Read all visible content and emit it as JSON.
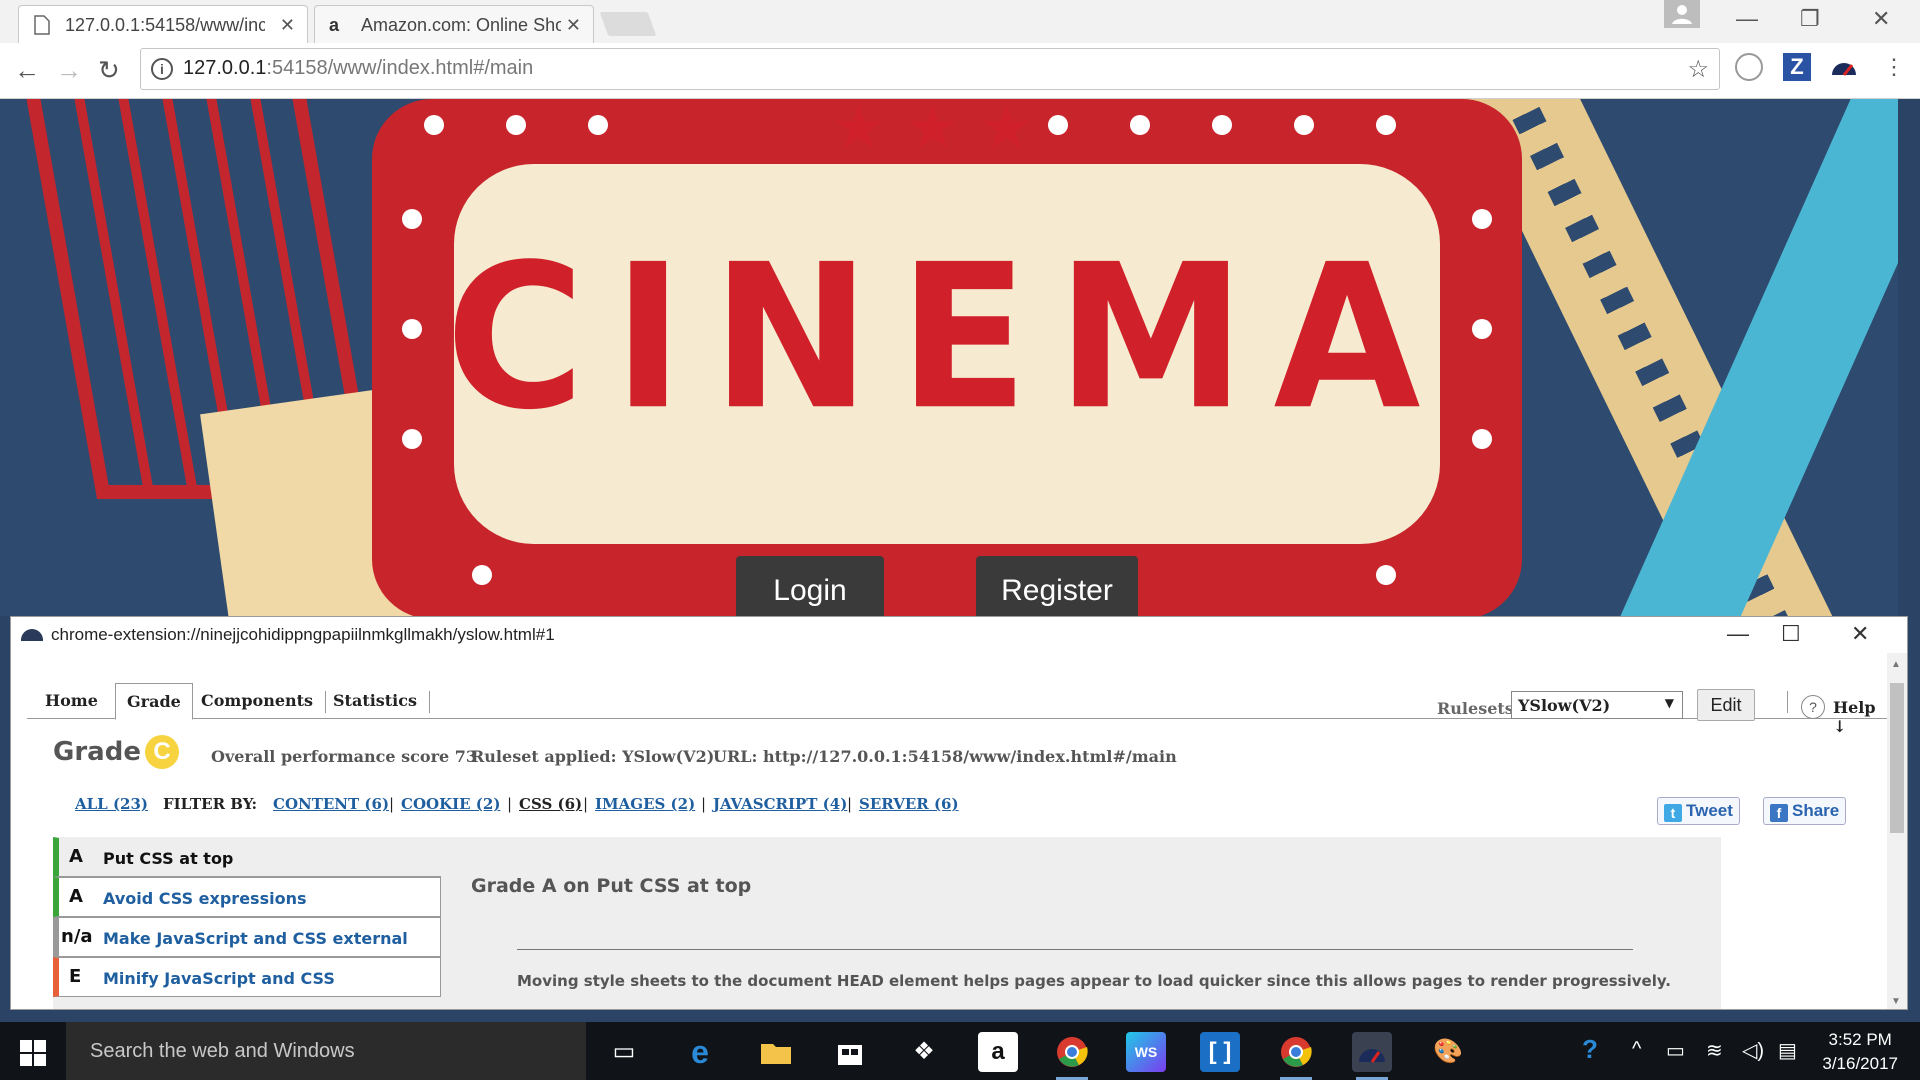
{
  "browser": {
    "tabs": [
      {
        "title": "127.0.0.1:54158/www/inc",
        "close": "✕"
      },
      {
        "title": "Amazon.com: Online Sho",
        "close": "✕"
      }
    ],
    "window_controls": {
      "minimize": "—",
      "restore": "❐",
      "close": "✕"
    },
    "nav": {
      "back": "←",
      "forward": "→",
      "reload": "↻"
    },
    "url_host": "127.0.0.1",
    "url_rest": ":54158/www/index.html#/main",
    "star": "☆"
  },
  "page": {
    "logo_text": "CINEMA",
    "stars": "★★★",
    "login_label": "Login",
    "register_label": "Register"
  },
  "yslow": {
    "window_title": "chrome-extension://ninejjcohidippngpapiilnmkgllmakh/yslow.html#1",
    "window_controls": {
      "minimize": "—",
      "maximize": "☐",
      "close": "✕"
    },
    "tabs": [
      "Home",
      "Grade",
      "Components",
      "Statistics"
    ],
    "rulesets_label": "Rulesets",
    "ruleset_value": "YSlow(V2)",
    "edit_label": "Edit",
    "help_label": "Help ↓",
    "help_icon": "?",
    "grade_label": "Grade",
    "grade_value": "C",
    "overall_score": "Overall performance score 73",
    "ruleset_applied": "Ruleset applied: YSlow(V2)",
    "url_text": "URL: http://127.0.0.1:54158/www/index.html#/main",
    "filters": {
      "all": "ALL (23)",
      "filter_by": "FILTER BY:",
      "content": "CONTENT (6)",
      "cookie": "COOKIE (2)",
      "css": "CSS (6)",
      "images": "IMAGES (2)",
      "javascript": "JAVASCRIPT (4)",
      "server": "SERVER (6)"
    },
    "tweet_label": "Tweet",
    "share_label": "Share",
    "rules": [
      {
        "grade": "A",
        "name": "Put CSS at top",
        "color": "#3aa63a"
      },
      {
        "grade": "A",
        "name": "Avoid CSS expressions",
        "color": "#3aa63a"
      },
      {
        "grade": "n/a",
        "name": "Make JavaScript and CSS external",
        "color": "#999999"
      },
      {
        "grade": "E",
        "name": "Minify JavaScript and CSS",
        "color": "#e8603a"
      }
    ],
    "detail_title": "Grade A on Put CSS at top",
    "detail_desc": "Moving style sheets to the document HEAD element helps pages appear to load quicker since this allows pages to render progressively."
  },
  "taskbar": {
    "search_placeholder": "Search the web and Windows",
    "time": "3:52 PM",
    "date": "3/16/2017"
  }
}
